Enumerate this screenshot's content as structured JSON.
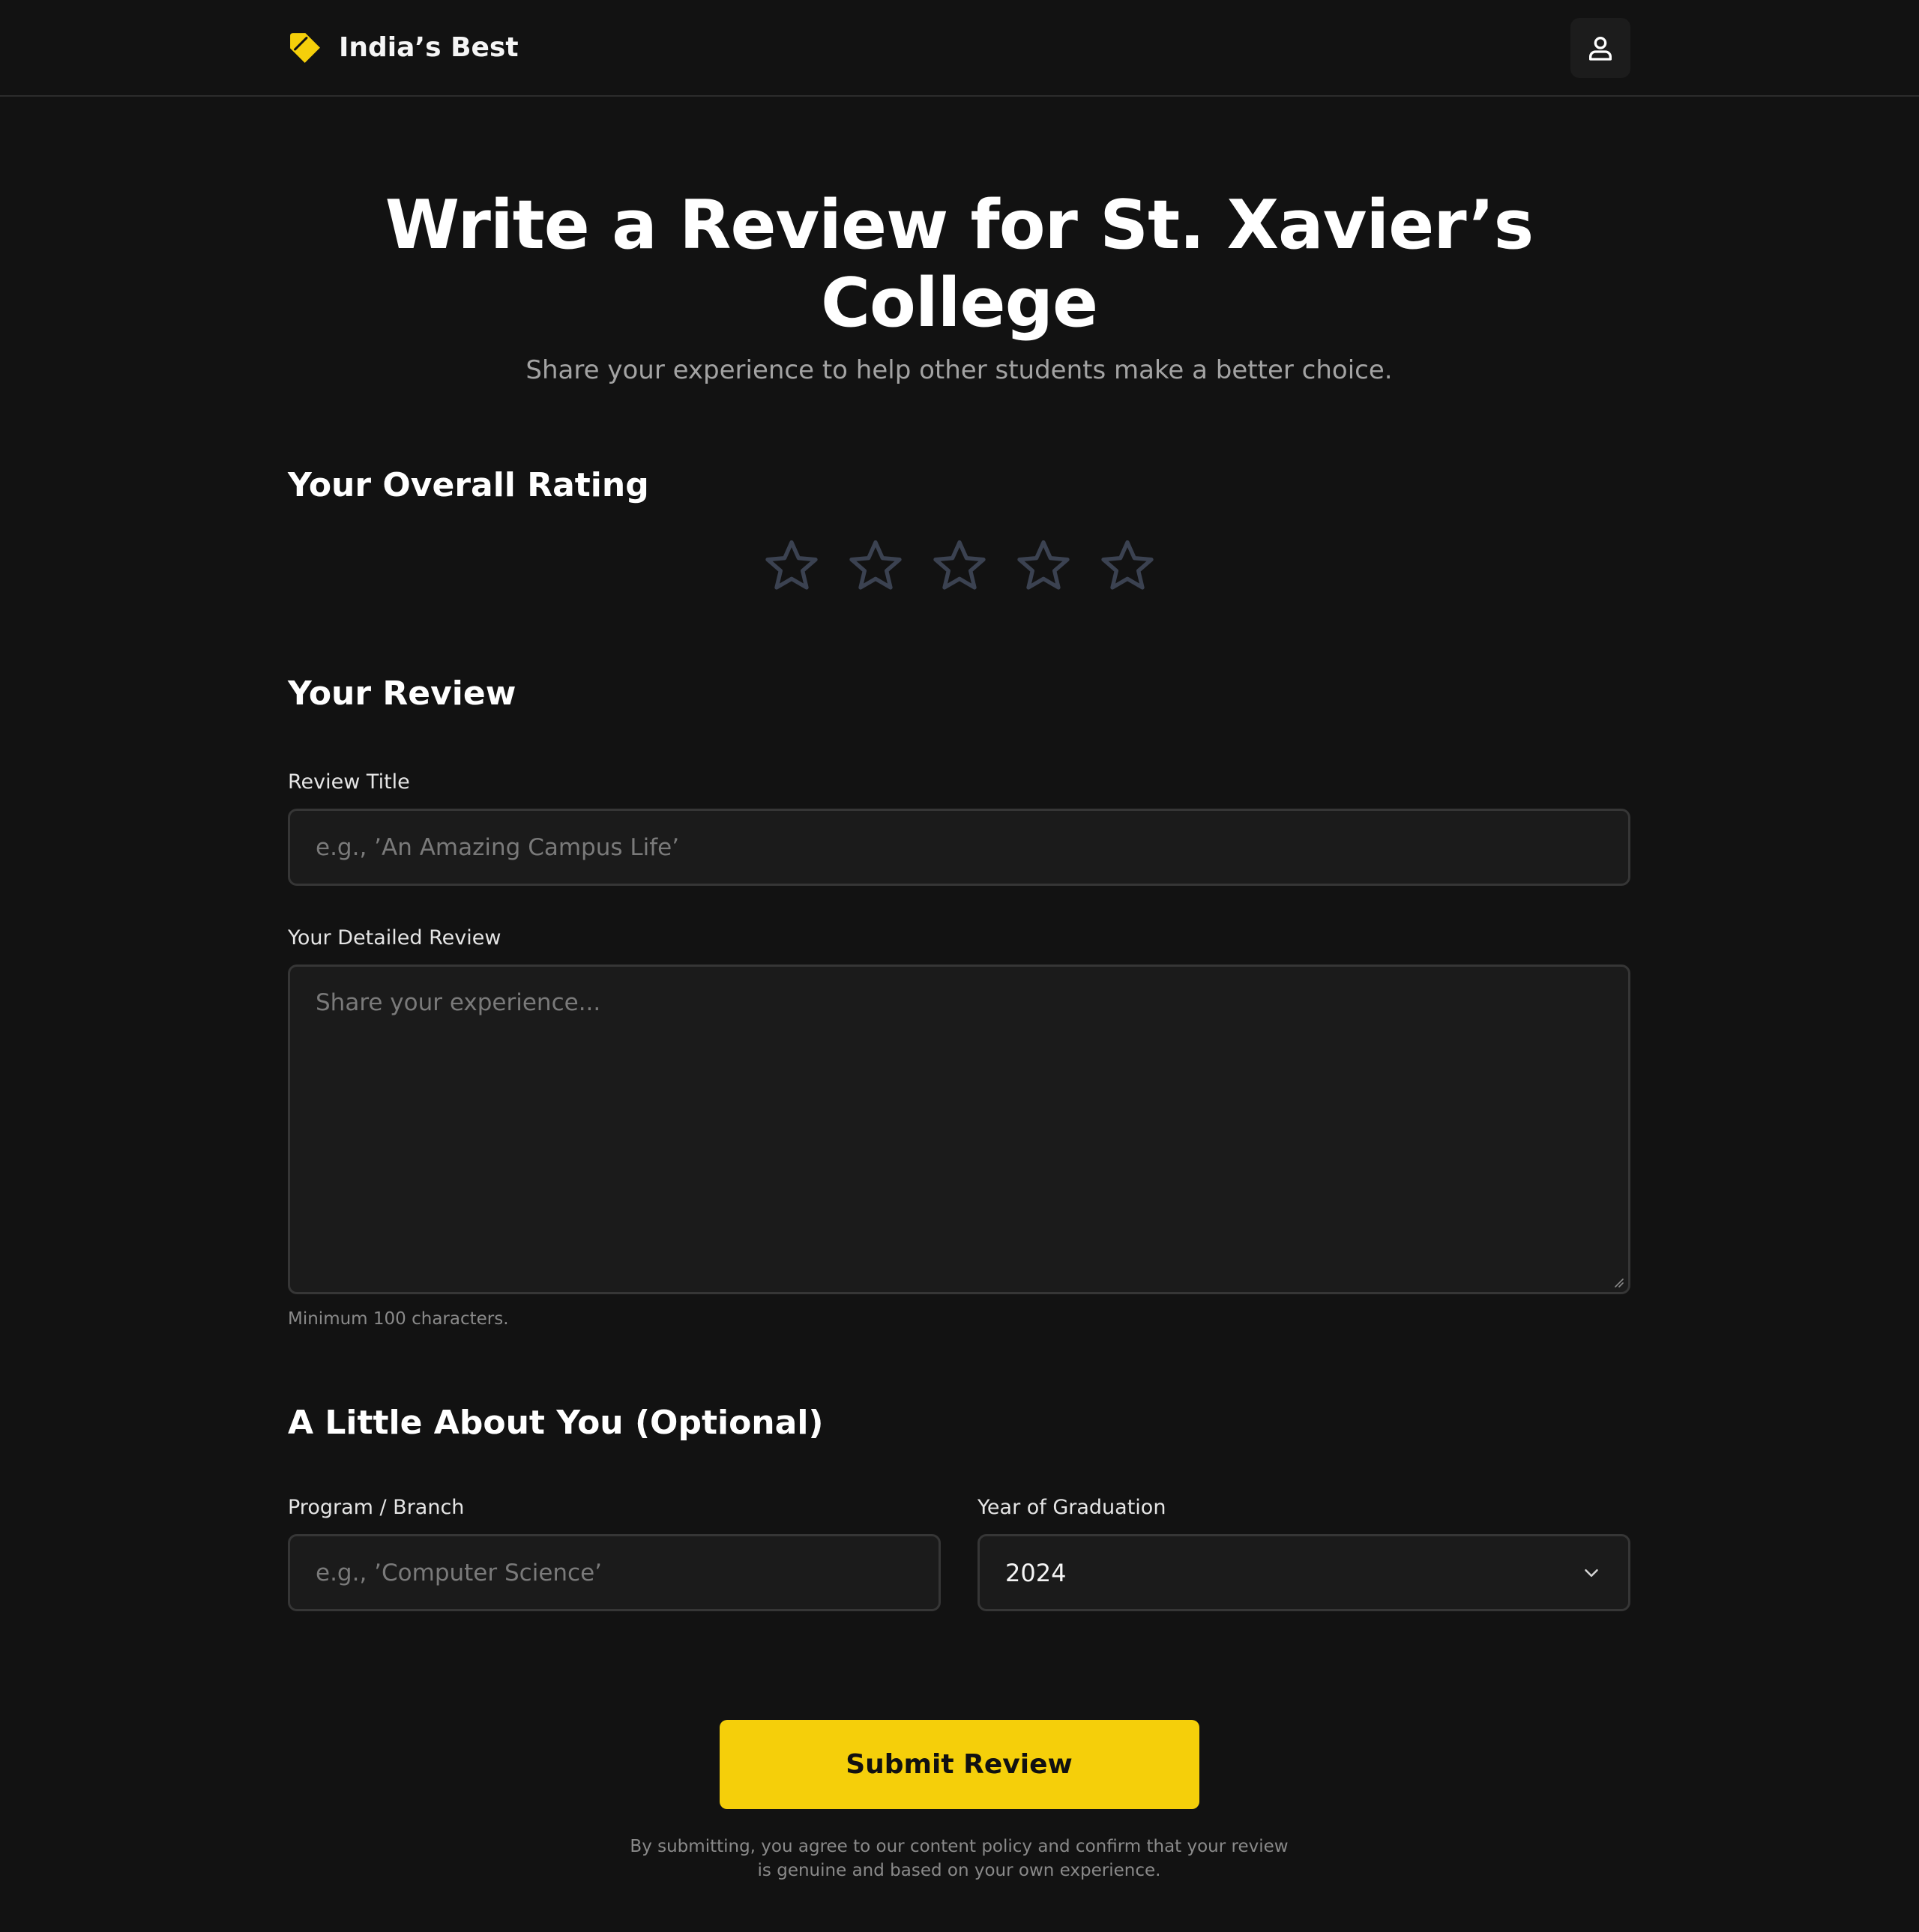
{
  "brand": {
    "name": "India’s Best",
    "logo_icon": "tag-icon",
    "accent": "#f5cf0a"
  },
  "header": {
    "account_icon": "user-icon"
  },
  "page": {
    "title": "Write a Review for St. Xavier’s College",
    "subtitle": "Share your experience to help other students make a better choice."
  },
  "rating": {
    "heading": "Your Overall Rating",
    "max": 5,
    "value": 0,
    "star_empty_color": "#3b4251"
  },
  "review": {
    "heading": "Your Review",
    "title_label": "Review Title",
    "title_placeholder": "e.g., ’An Amazing Campus Life’",
    "detail_label": "Your Detailed Review",
    "detail_placeholder": "Share your experience...",
    "hint": "Minimum 100 characters."
  },
  "about": {
    "heading": "A Little About You (Optional)",
    "program_label": "Program / Branch",
    "program_placeholder": "e.g., ’Computer Science’",
    "year_label": "Year of Graduation",
    "year_value": "2024"
  },
  "submit": {
    "label": "Submit Review",
    "disclaimer_line1": "By submitting, you agree to our content policy and confirm that your review",
    "disclaimer_line2": "is genuine and based on your own experience."
  }
}
